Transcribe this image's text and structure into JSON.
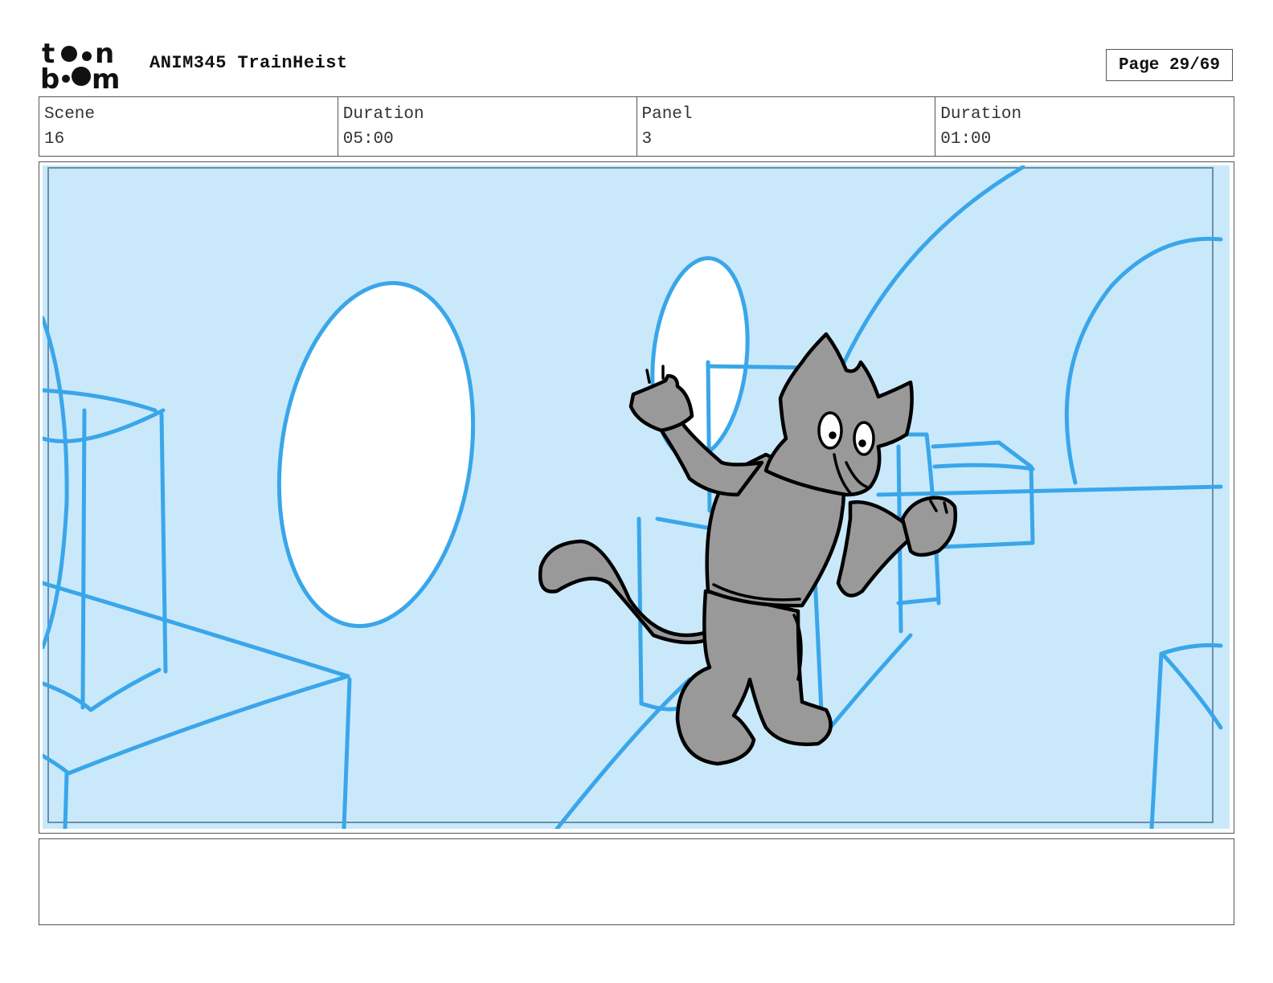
{
  "header": {
    "logo_text": "toon boom",
    "title": "ANIM345 TrainHeist",
    "page": "Page 29/69"
  },
  "info": [
    {
      "label": "Scene",
      "value": "16"
    },
    {
      "label": "Duration",
      "value": "05:00"
    },
    {
      "label": "Panel",
      "value": "3"
    },
    {
      "label": "Duration",
      "value": "01:00"
    }
  ],
  "panel": {
    "background_color": "#c9e9fb",
    "line_color": "#3aa6ea",
    "character_fill": "#999999"
  },
  "notes": {
    "text": ""
  }
}
